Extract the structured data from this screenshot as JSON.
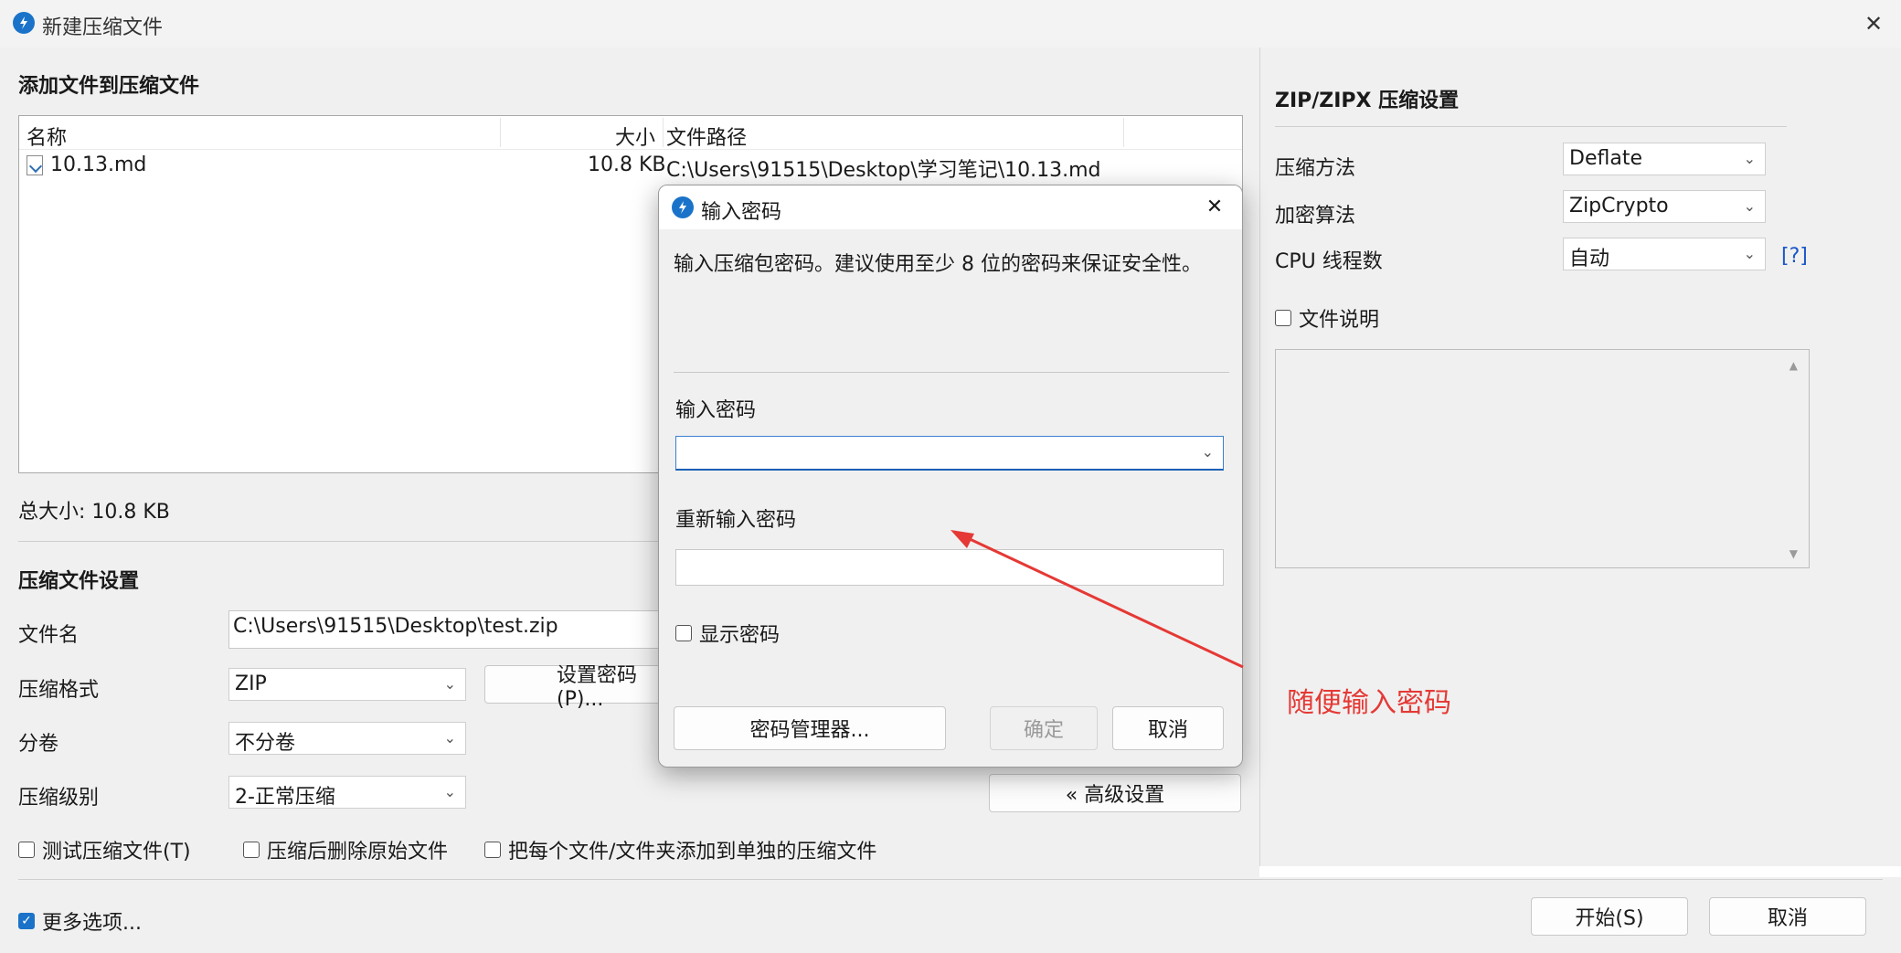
{
  "window": {
    "title": "新建压缩文件",
    "close_glyph": "✕"
  },
  "files": {
    "heading": "添加文件到压缩文件",
    "columns": {
      "name": "名称",
      "size": "大小",
      "path": "文件路径"
    },
    "rows": [
      {
        "name": "10.13.md",
        "size": "10.8 KB",
        "path": "C:\\Users\\91515\\Desktop\\学习笔记\\10.13.md"
      }
    ],
    "total": "总大小: 10.8 KB"
  },
  "settings": {
    "heading": "压缩文件设置",
    "filename_label": "文件名",
    "filename_value": "C:\\Users\\91515\\Desktop\\test.zip",
    "format_label": "压缩格式",
    "format_value": "ZIP",
    "set_password_button": "设置密码(P)...",
    "volume_label": "分卷",
    "volume_value": "不分卷",
    "level_label": "压缩级别",
    "level_value": "2-正常压缩",
    "advanced_button": "« 高级设置",
    "test_checkbox": "测试压缩文件(T)",
    "delete_checkbox": "压缩后删除原始文件",
    "separate_checkbox": "把每个文件/文件夹添加到单独的压缩文件"
  },
  "zip_settings": {
    "heading": "ZIP/ZIPX 压缩设置",
    "method_label": "压缩方法",
    "method_value": "Deflate",
    "encryption_label": "加密算法",
    "encryption_value": "ZipCrypto",
    "threads_label": "CPU 线程数",
    "threads_value": "自动",
    "help_link": "[?]",
    "comment_checkbox": "文件说明"
  },
  "footer": {
    "more_options": "更多选项...",
    "more_options_checked": true,
    "start_button": "开始(S)",
    "cancel_button": "取消"
  },
  "password_dialog": {
    "title": "输入密码",
    "description": "输入压缩包密码。建议使用至少 8 位的密码来保证安全性。",
    "password_label": "输入密码",
    "password_value": "",
    "reenter_label": "重新输入密码",
    "reenter_value": "",
    "show_password": "显示密码",
    "manager_button": "密码管理器...",
    "ok_button": "确定",
    "cancel_button": "取消"
  },
  "annotation": {
    "text": "随便输入密码",
    "color": "#e53935"
  },
  "colors": {
    "accent": "#1a73c9",
    "link": "#1a56c9",
    "annotation": "#e53935"
  }
}
